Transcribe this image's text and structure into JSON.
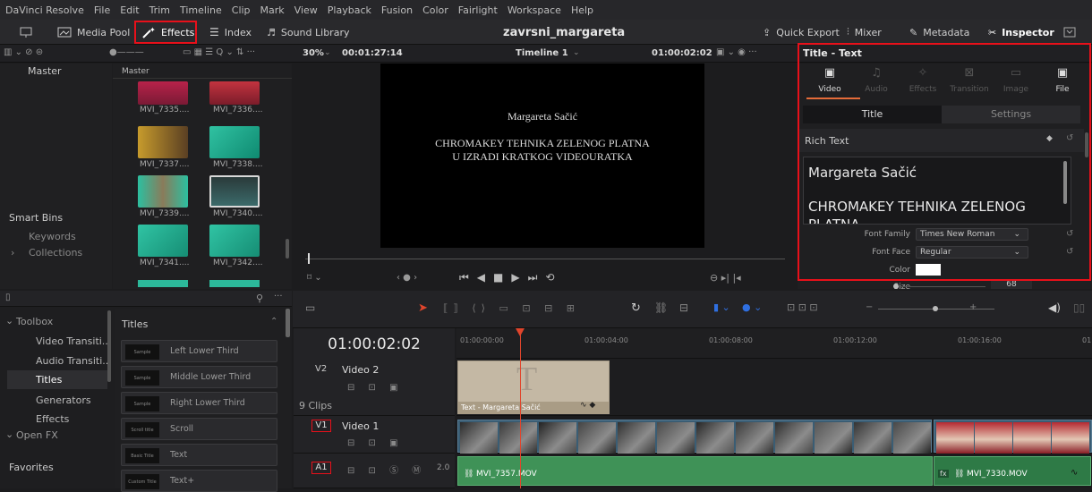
{
  "menu": [
    "DaVinci Resolve",
    "File",
    "Edit",
    "Trim",
    "Timeline",
    "Clip",
    "Mark",
    "View",
    "Playback",
    "Fusion",
    "Color",
    "Fairlight",
    "Workspace",
    "Help"
  ],
  "toolbar": {
    "media_pool": "Media Pool",
    "effects": "Effects",
    "index": "Index",
    "sound_library": "Sound Library",
    "project_name": "zavrsni_margareta",
    "quick_export": "Quick Export",
    "mixer": "Mixer",
    "metadata": "Metadata",
    "inspector": "Inspector"
  },
  "viewer": {
    "zoom": "30%",
    "duration": "00:01:27:14",
    "timeline_name": "Timeline 1",
    "timecode": "01:00:02:02"
  },
  "viewer_text": {
    "line1": "Margareta Sačić",
    "line2": "CHROMAKEY TEHNIKA ZELENOG PLATNA",
    "line3": "U IZRADI KRATKOG VIDEOURATKA"
  },
  "media_pool": {
    "master_left": "Master",
    "master_header": "Master",
    "clips": [
      "MVI_7335....",
      "MVI_7336....",
      "MVI_7337....",
      "MVI_7338....",
      "MVI_7339....",
      "MVI_7340....",
      "MVI_7341....",
      "MVI_7342...."
    ],
    "smart_bins": "Smart Bins",
    "keywords": "Keywords",
    "collections": "Collections"
  },
  "effects_panel": {
    "toolbox": "Toolbox",
    "video_transitions": "Video Transiti...",
    "audio_transitions": "Audio Transiti...",
    "titles": "Titles",
    "generators": "Generators",
    "effects": "Effects",
    "open_fx": "Open FX",
    "favorites": "Favorites",
    "titles_header": "Titles",
    "title_items": [
      {
        "thumb": "Sample",
        "label": "Left Lower Third"
      },
      {
        "thumb": "Sample",
        "label": "Middle Lower Third"
      },
      {
        "thumb": "Sample",
        "label": "Right Lower Third"
      },
      {
        "thumb": "Scroll title",
        "label": "Scroll"
      },
      {
        "thumb": "Basic Title",
        "label": "Text"
      },
      {
        "thumb": "Custom Title",
        "label": "Text+"
      }
    ]
  },
  "timeline": {
    "timecode": "01:00:02:02",
    "ruler": [
      "01:00:00:00",
      "01:00:04:00",
      "01:00:08:00",
      "01:00:12:00",
      "01:00:16:00",
      "01:"
    ],
    "v2_id": "V2",
    "v2_name": "Video 2",
    "clip_count": "9 Clips",
    "v1_id": "V1",
    "v1_name": "Video 1",
    "a1_id": "A1",
    "a1_level": "2.0",
    "title_clip": "Text - Margareta Sačić",
    "audio_clip1": "MVI_7357.MOV",
    "audio_clip2": "MVI_7330.MOV"
  },
  "inspector": {
    "title": "Title - Text",
    "tabs": [
      "Video",
      "Audio",
      "Effects",
      "Transition",
      "Image",
      "File"
    ],
    "subtab_title": "Title",
    "subtab_settings": "Settings",
    "rich_text_label": "Rich Text",
    "rich_text_line1": "Margareta Sačić",
    "rich_text_line2": "CHROMAKEY TEHNIKA ZELENOG",
    "rich_text_line3": "PLATNA",
    "font_family_label": "Font Family",
    "font_family_value": "Times New Roman",
    "font_face_label": "Font Face",
    "font_face_value": "Regular",
    "color_label": "Color",
    "size_label": "Size",
    "size_value": "68"
  },
  "colors": {
    "highlight_red": "#e8101a",
    "playhead": "#e0452c",
    "video_clip": "#3a5d74",
    "audio_clip": "#3f9257",
    "accent_orange": "#e56b39"
  }
}
